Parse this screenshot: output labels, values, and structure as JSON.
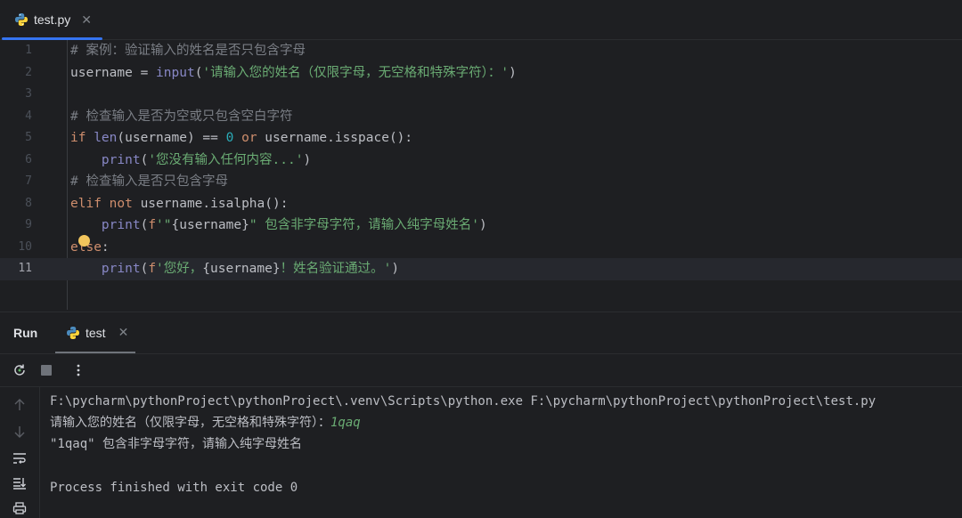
{
  "editor_tab": {
    "file_name": "test.py",
    "close_symbol": "✕"
  },
  "editor": {
    "line_numbers": [
      "1",
      "2",
      "3",
      "4",
      "5",
      "6",
      "7",
      "8",
      "9",
      "10",
      "11"
    ],
    "active_line": 11,
    "lines": [
      [
        {
          "t": "# 案例：验证输入的姓名是否只包含字母",
          "c": "cm"
        }
      ],
      [
        {
          "t": "username = ",
          "c": ""
        },
        {
          "t": "input",
          "c": "bi"
        },
        {
          "t": "(",
          "c": ""
        },
        {
          "t": "'请输入您的姓名（仅限字母，无空格和特殊字符）：'",
          "c": "str"
        },
        {
          "t": ")",
          "c": ""
        }
      ],
      [],
      [
        {
          "t": "# 检查输入是否为空或只包含空白字符",
          "c": "cm"
        }
      ],
      [
        {
          "t": "if ",
          "c": "kw"
        },
        {
          "t": "len",
          "c": "bi"
        },
        {
          "t": "(username) == ",
          "c": ""
        },
        {
          "t": "0",
          "c": "num"
        },
        {
          "t": " or ",
          "c": "kw"
        },
        {
          "t": "username.isspace():",
          "c": ""
        }
      ],
      [
        {
          "t": "    ",
          "c": ""
        },
        {
          "t": "print",
          "c": "bi"
        },
        {
          "t": "(",
          "c": ""
        },
        {
          "t": "'您没有输入任何内容...'",
          "c": "str"
        },
        {
          "t": ")",
          "c": ""
        }
      ],
      [
        {
          "t": "# 检查输入是否只包含字母",
          "c": "cm"
        }
      ],
      [
        {
          "t": "elif not ",
          "c": "kw"
        },
        {
          "t": "username.isalpha():",
          "c": ""
        }
      ],
      [
        {
          "t": "    ",
          "c": ""
        },
        {
          "t": "print",
          "c": "bi"
        },
        {
          "t": "(",
          "c": ""
        },
        {
          "t": "f",
          "c": "fs"
        },
        {
          "t": "'\"",
          "c": "str"
        },
        {
          "t": "{username}",
          "c": "interp"
        },
        {
          "t": "\" 包含非字母字符，请输入纯字母姓名'",
          "c": "str"
        },
        {
          "t": ")",
          "c": ""
        }
      ],
      [
        {
          "t": "else",
          "c": "kw"
        },
        {
          "t": ":",
          "c": ""
        }
      ],
      [
        {
          "t": "    ",
          "c": ""
        },
        {
          "t": "print",
          "c": "bi"
        },
        {
          "t": "(",
          "c": ""
        },
        {
          "t": "f",
          "c": "fs"
        },
        {
          "t": "'您好，",
          "c": "str"
        },
        {
          "t": "{username}",
          "c": "interp"
        },
        {
          "t": "！姓名验证通过。'",
          "c": "str"
        },
        {
          "t": ")",
          "c": ""
        }
      ]
    ]
  },
  "run_panel": {
    "title": "Run",
    "tab_label": "test",
    "close_symbol": "✕",
    "console": {
      "command": "F:\\pycharm\\pythonProject\\pythonProject\\.venv\\Scripts\\python.exe F:\\pycharm\\pythonProject\\pythonProject\\test.py",
      "prompt": "请输入您的姓名（仅限字母，无空格和特殊字符）：",
      "user_input": "1qaq",
      "output": "\"1qaq\" 包含非字母字符，请输入纯字母姓名",
      "exit_message": "Process finished with exit code 0"
    }
  },
  "colors": {
    "accent": "#3574f0",
    "string": "#6aab73",
    "keyword": "#cf8e6d",
    "builtin": "#8888c6",
    "number": "#2aacb8",
    "comment": "#7a7e85"
  },
  "icons": [
    "python-file-icon",
    "rerun-icon",
    "stop-icon",
    "more-options-icon",
    "scroll-up-icon",
    "scroll-down-icon",
    "soft-wrap-icon",
    "scroll-to-end-icon",
    "print-icon"
  ]
}
